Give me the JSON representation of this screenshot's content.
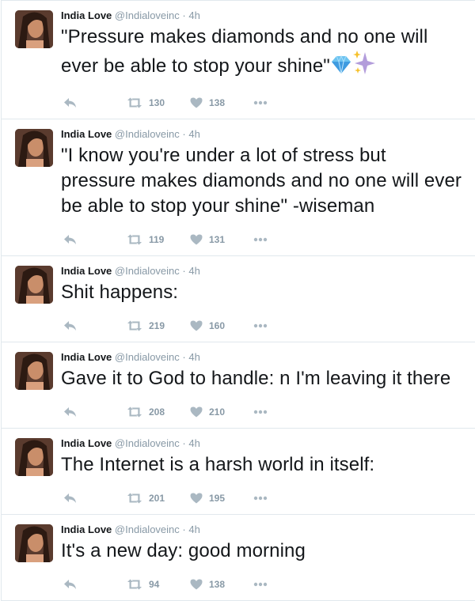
{
  "colors": {
    "name": "#14171a",
    "meta": "#8899a6",
    "icon": "#aab8c2",
    "border": "#e1e8ed"
  },
  "tweets": [
    {
      "name": "India Love",
      "handle": "@Indialoveinc",
      "dot": "·",
      "time": "4h",
      "text": "\"Pressure makes diamonds and no one will ever be able to stop your shine\"",
      "emojis": [
        "gem-icon",
        "sparkles-icon"
      ],
      "retweets": "130",
      "likes": "138"
    },
    {
      "name": "India Love",
      "handle": "@Indialoveinc",
      "dot": "·",
      "time": "4h",
      "text": "\"I know you're under a lot of stress but pressure makes diamonds and no one will ever be able to stop your shine\" -wiseman",
      "retweets": "119",
      "likes": "131"
    },
    {
      "name": "India Love",
      "handle": "@Indialoveinc",
      "dot": "·",
      "time": "4h",
      "text": "Shit happens:",
      "retweets": "219",
      "likes": "160"
    },
    {
      "name": "India Love",
      "handle": "@Indialoveinc",
      "dot": "·",
      "time": "4h",
      "text": "Gave it to God to handle: n I'm leaving it there",
      "retweets": "208",
      "likes": "210"
    },
    {
      "name": "India Love",
      "handle": "@Indialoveinc",
      "dot": "·",
      "time": "4h",
      "text": "The Internet is a harsh world in itself:",
      "retweets": "201",
      "likes": "195"
    },
    {
      "name": "India Love",
      "handle": "@Indialoveinc",
      "dot": "·",
      "time": "4h",
      "text": "It's a new day: good morning",
      "retweets": "94",
      "likes": "138"
    }
  ]
}
